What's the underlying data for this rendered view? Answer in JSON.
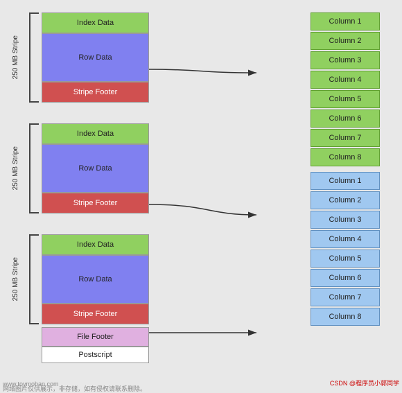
{
  "stripes": [
    {
      "label": "250 MB Stripe",
      "index_label": "Index Data",
      "row_label": "Row Data",
      "footer_label": "Stripe Footer"
    },
    {
      "label": "250 MB Stripe",
      "index_label": "Index Data",
      "row_label": "Row Data",
      "footer_label": "Stripe Footer"
    },
    {
      "label": "250 MB Stripe",
      "index_label": "Index Data",
      "row_label": "Row Data",
      "footer_label": "Stripe Footer"
    }
  ],
  "file_footer": {
    "label": "File Footer"
  },
  "postscript": {
    "label": "Postscript"
  },
  "column_groups": [
    {
      "color": "green",
      "columns": [
        "Column 1",
        "Column 2",
        "Column 3",
        "Column 4",
        "Column 5",
        "Column 6",
        "Column 7",
        "Column 8"
      ]
    },
    {
      "color": "blue",
      "columns": [
        "Column 1",
        "Column 2",
        "Column 3",
        "Column 4",
        "Column 5",
        "Column 6",
        "Column 7",
        "Column 8"
      ]
    }
  ],
  "watermark": {
    "line1": "www.toymoban.com",
    "line2": "网络图片仅供展示，非存储，如有侵权请联系删除。",
    "csdn": "CSDN @程序员小郭同学"
  }
}
